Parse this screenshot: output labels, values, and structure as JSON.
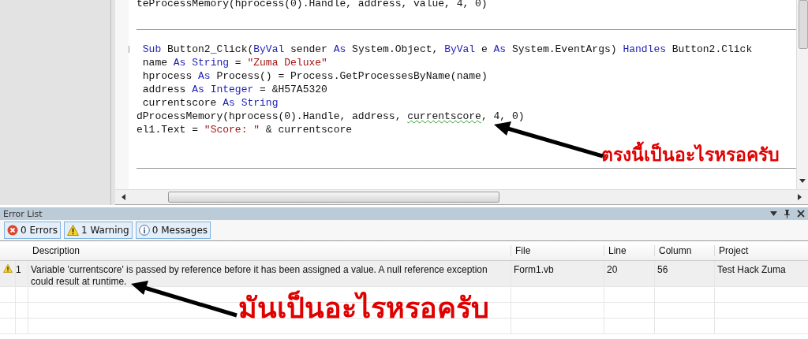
{
  "editor": {
    "lines": [
      {
        "segments": [
          {
            "kind": "plain",
            "text": "teProcessMemory(hprocess(0).Handle, address, value, 4, 0)"
          }
        ]
      },
      {
        "kind": "separator"
      },
      {
        "segments": [
          {
            "kind": "keyword",
            "text": " Sub"
          },
          {
            "kind": "plain",
            "text": " Button2_Click("
          },
          {
            "kind": "keyword",
            "text": "ByVal"
          },
          {
            "kind": "plain",
            "text": " sender "
          },
          {
            "kind": "keyword",
            "text": "As"
          },
          {
            "kind": "plain",
            "text": " System.Object, "
          },
          {
            "kind": "keyword",
            "text": "ByVal"
          },
          {
            "kind": "plain",
            "text": " e "
          },
          {
            "kind": "keyword",
            "text": "As"
          },
          {
            "kind": "plain",
            "text": " System.EventArgs) "
          },
          {
            "kind": "keyword",
            "text": "Handles"
          },
          {
            "kind": "plain",
            "text": " Button2.Click"
          }
        ],
        "fold": true
      },
      {
        "segments": [
          {
            "kind": "plain",
            "text": " name "
          },
          {
            "kind": "keyword",
            "text": "As"
          },
          {
            "kind": "keyword",
            "text": " String"
          },
          {
            "kind": "plain",
            "text": " = "
          },
          {
            "kind": "string",
            "text": "\"Zuma Deluxe\""
          }
        ]
      },
      {
        "segments": [
          {
            "kind": "plain",
            "text": " hprocess "
          },
          {
            "kind": "keyword",
            "text": "As"
          },
          {
            "kind": "plain",
            "text": " Process() = Process.GetProcessesByName(name)"
          }
        ]
      },
      {
        "segments": [
          {
            "kind": "plain",
            "text": " address "
          },
          {
            "kind": "keyword",
            "text": "As"
          },
          {
            "kind": "keyword",
            "text": " Integer"
          },
          {
            "kind": "plain",
            "text": " = &H57A5320"
          }
        ]
      },
      {
        "segments": [
          {
            "kind": "plain",
            "text": " currentscore "
          },
          {
            "kind": "keyword",
            "text": "As"
          },
          {
            "kind": "keyword",
            "text": " String"
          }
        ]
      },
      {
        "segments": [
          {
            "kind": "plain",
            "text": "dProcessMemory(hprocess(0).Handle, address, "
          },
          {
            "kind": "warning",
            "text": "currentscore"
          },
          {
            "kind": "plain",
            "text": ", 4, 0)"
          }
        ]
      },
      {
        "segments": [
          {
            "kind": "plain",
            "text": "el1.Text = "
          },
          {
            "kind": "string",
            "text": "\"Score: \""
          },
          {
            "kind": "plain",
            "text": " & currentscore"
          }
        ]
      }
    ]
  },
  "error_list": {
    "title": "Error List",
    "filters": [
      {
        "kind": "error",
        "label": "0 Errors",
        "selected": true
      },
      {
        "kind": "warning",
        "label": "1 Warning",
        "selected": true
      },
      {
        "kind": "info",
        "label": "0 Messages",
        "selected": true
      }
    ],
    "columns": [
      "Description",
      "File",
      "Line",
      "Column",
      "Project"
    ],
    "rows": [
      {
        "kind": "warning",
        "number": "1",
        "description": "Variable 'currentscore' is passed by reference before it has been assigned a value. A null reference exception could result at runtime.",
        "file": "Form1.vb",
        "line": "20",
        "column": "56",
        "project": "Test Hack Zuma",
        "selected": true
      }
    ]
  },
  "annotations": [
    {
      "text": "ตรงนี้เป็นอะไรหรอครับ"
    },
    {
      "text": "มันเป็นอะไรหรอครับ"
    }
  ]
}
